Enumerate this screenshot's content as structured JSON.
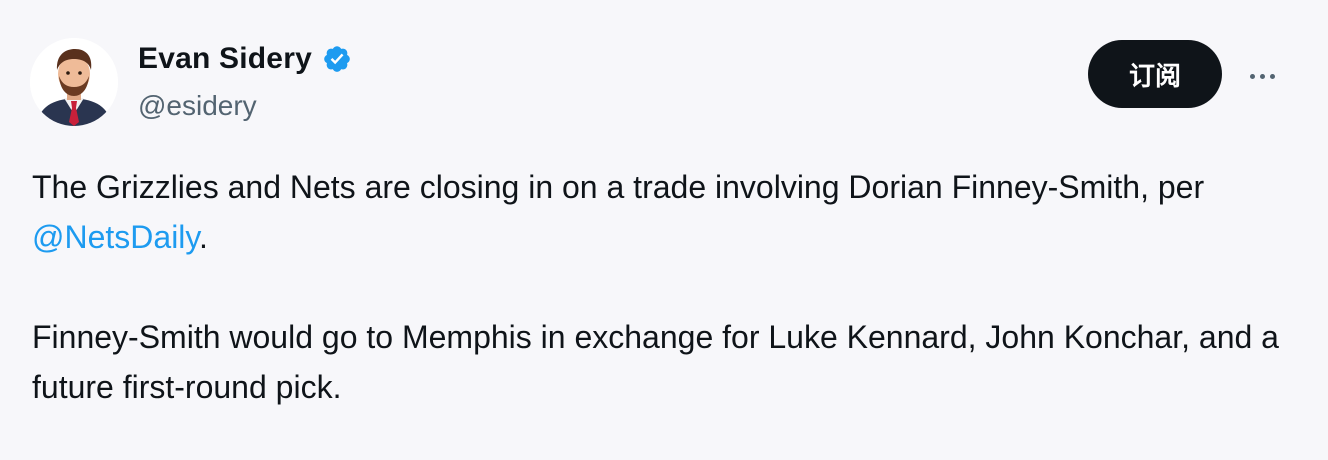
{
  "author": {
    "display_name": "Evan Sidery",
    "handle": "@esidery",
    "verified_icon": "verified-badge-icon",
    "verified_color": "#1d9bf0"
  },
  "actions": {
    "subscribe_label": "订阅",
    "more_icon": "more-horizontal-icon"
  },
  "tweet": {
    "paragraph1_before": "The Grizzlies and Nets are closing in on a trade involving Dorian Finney-Smith, per ",
    "mention": "@NetsDaily",
    "paragraph1_after": ".",
    "paragraph2": "Finney-Smith would go to Memphis in exchange for Luke Kennard, John Konchar, and a future first-round pick."
  },
  "colors": {
    "link": "#1d9bf0",
    "text": "#0f1419",
    "secondary": "#536471",
    "button_bg": "#0f1419"
  }
}
